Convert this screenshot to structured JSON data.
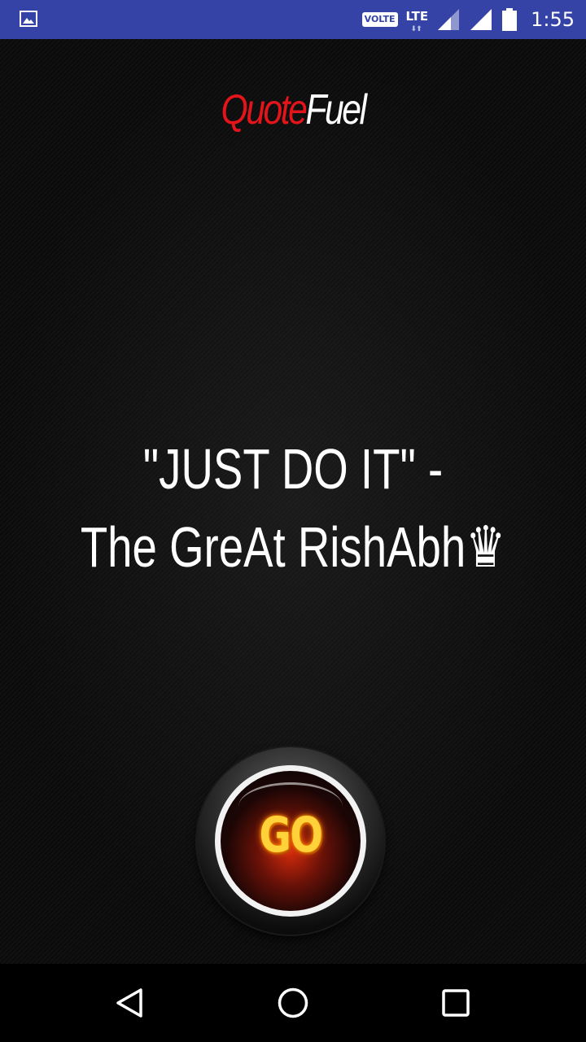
{
  "status_bar": {
    "volte_label": "VOLTE",
    "network_label": "LTE",
    "network_arrows": "⬇⬆",
    "time": "1:55",
    "icons": [
      "gallery-icon",
      "signal-icon",
      "signal-icon",
      "battery-icon"
    ]
  },
  "app": {
    "title_part1": "Quote",
    "title_part2": "Fuel",
    "title_colors": {
      "part1": "#e3141a",
      "part2": "#ffffff"
    }
  },
  "quote": {
    "line1": "\"JUST DO IT\" -",
    "line2": "The GreAt RishAbh♛"
  },
  "go_button": {
    "label": "GO",
    "accent": "#ffd23a"
  },
  "nav_bar": {
    "icons": [
      "back-icon",
      "home-icon",
      "recents-icon"
    ]
  },
  "colors": {
    "status_bar_bg": "#3543a6",
    "background": "#050505"
  }
}
